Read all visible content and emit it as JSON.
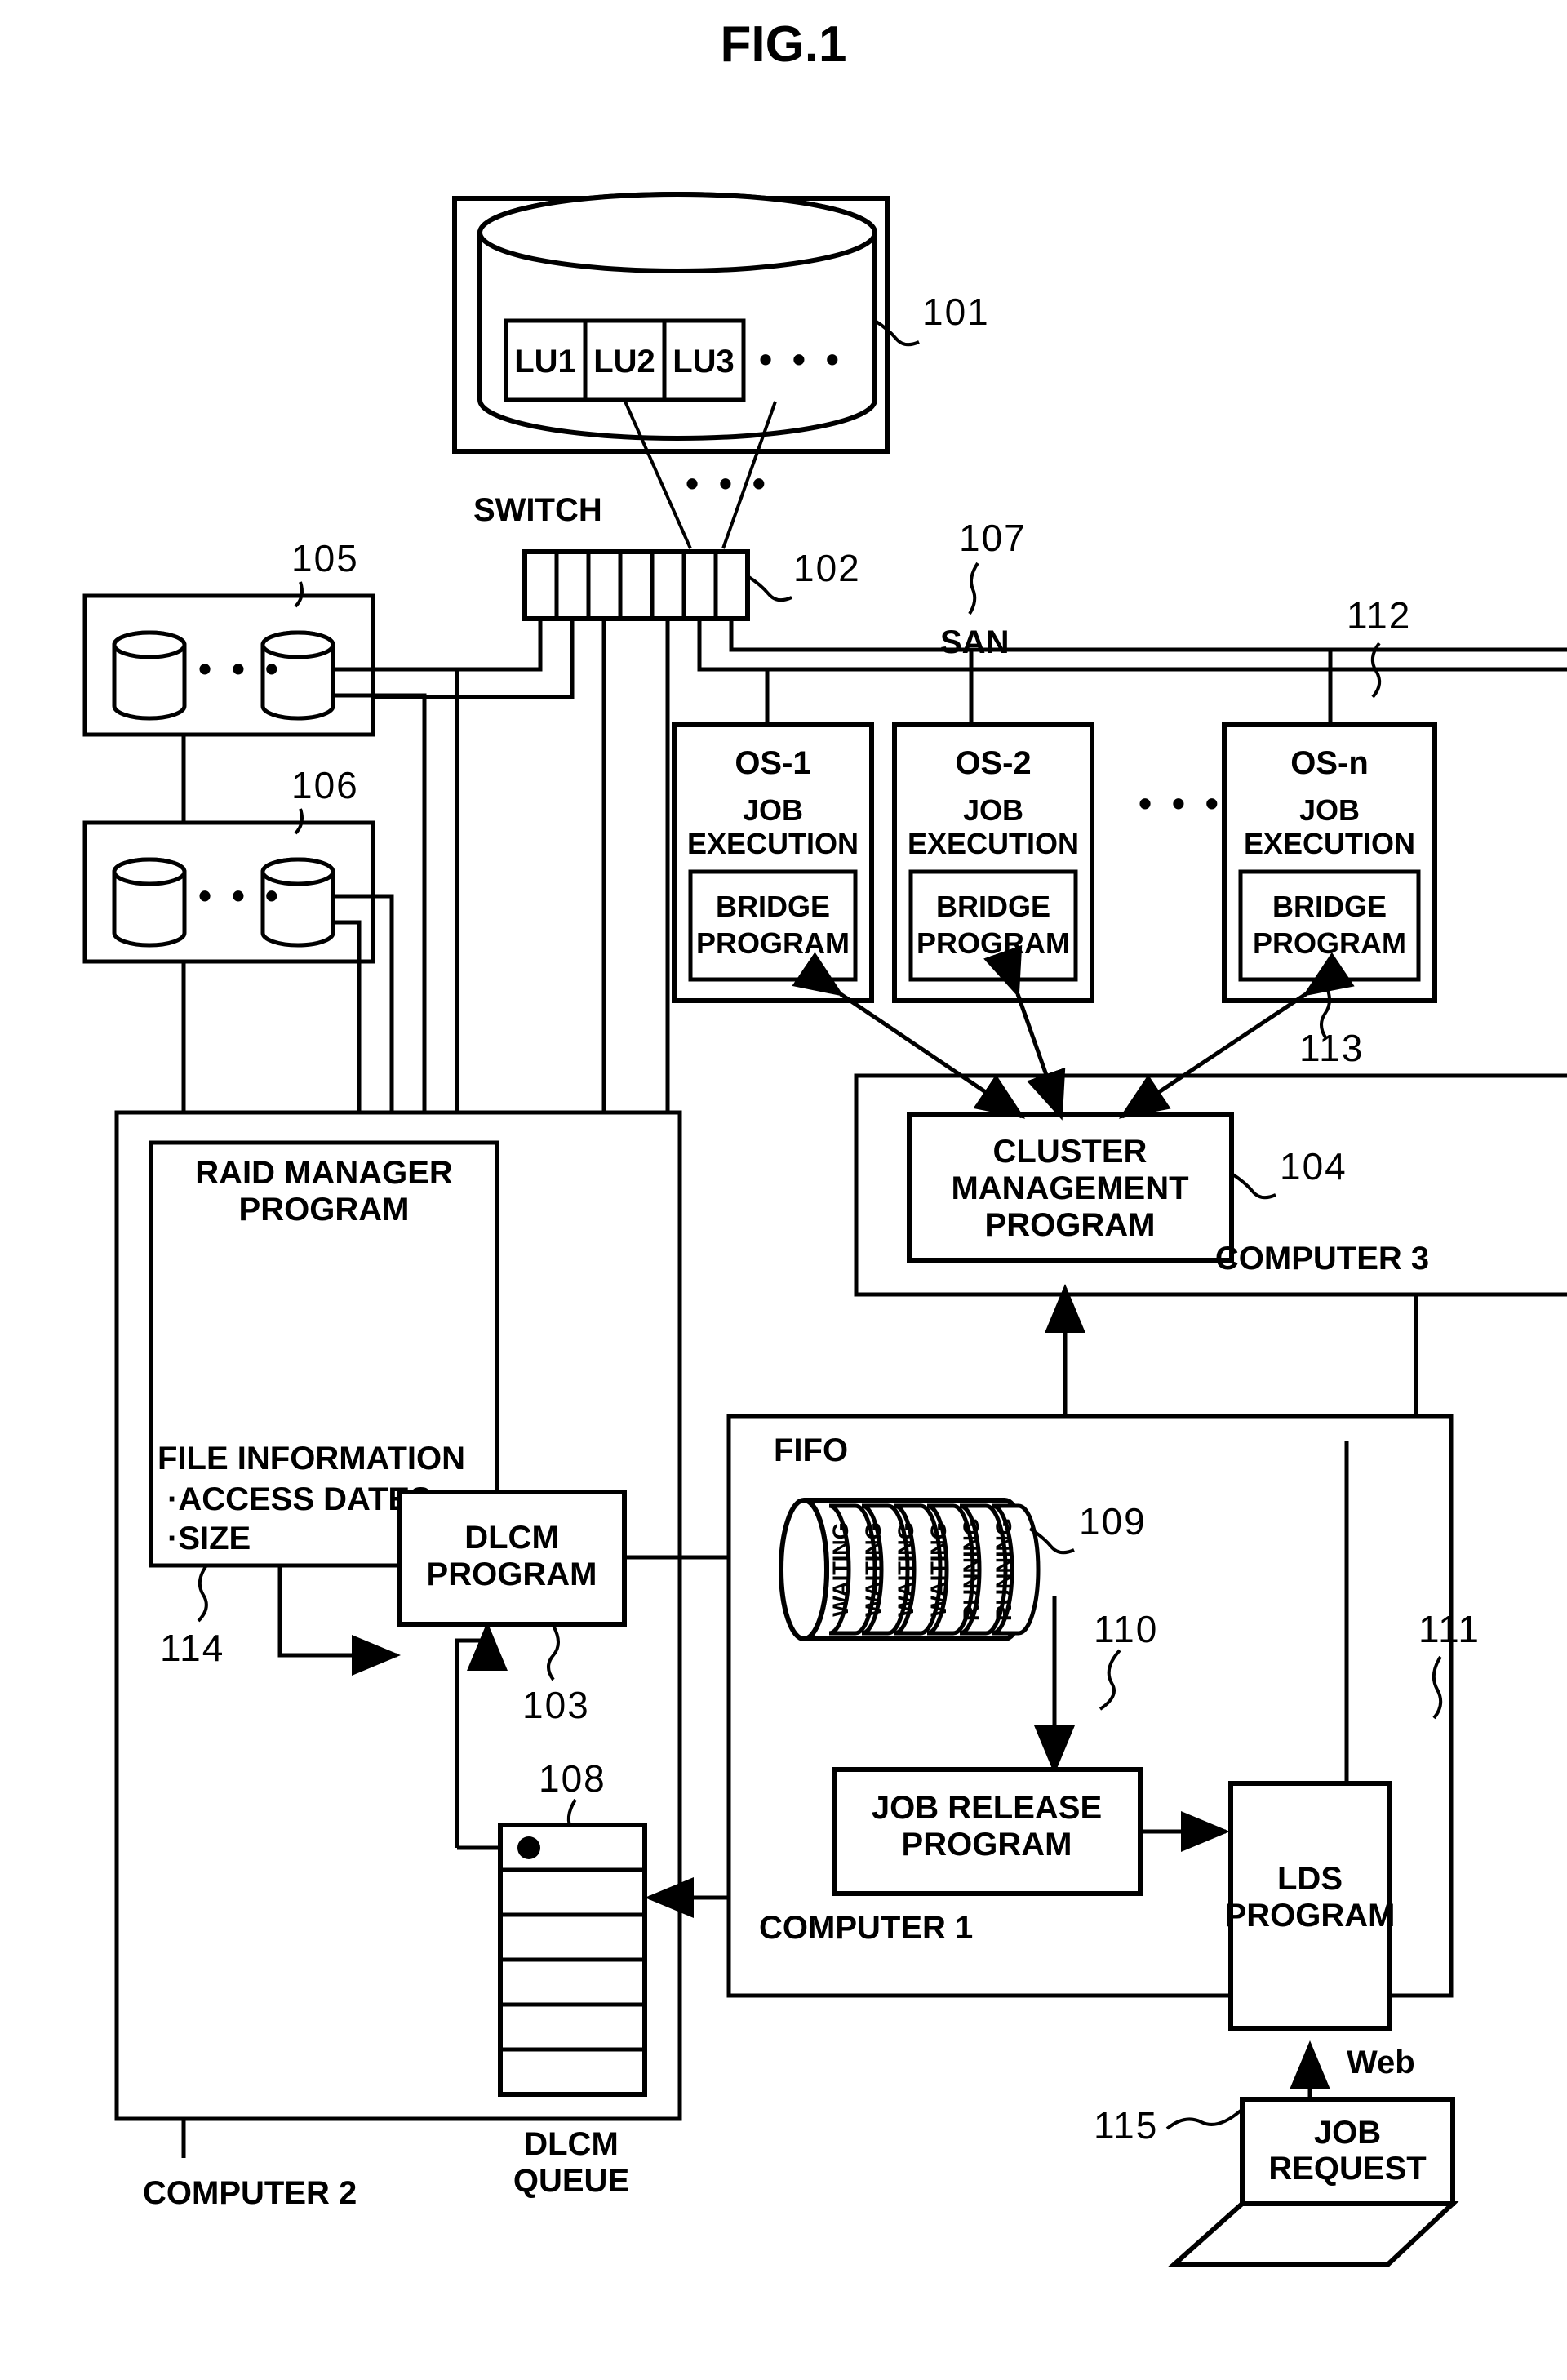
{
  "figure": {
    "title": "FIG.1"
  },
  "storage": {
    "ref": "101",
    "lus": [
      "LU1",
      "LU2",
      "LU3"
    ],
    "lu_ellipsis": "• • •",
    "link_ellipsis": "• • •"
  },
  "switch": {
    "label": "SWITCH",
    "ref": "102",
    "port_count": 7
  },
  "san": {
    "label": "SAN",
    "ref": "107"
  },
  "disk_arrays": [
    {
      "ref": "105",
      "ellipsis": "• • •"
    },
    {
      "ref": "106",
      "ellipsis": "• • •"
    }
  ],
  "os_nodes": [
    {
      "name": "OS-1",
      "line1": "JOB",
      "line2": "EXECUTION",
      "bridge_line1": "BRIDGE",
      "bridge_line2": "PROGRAM"
    },
    {
      "name": "OS-2",
      "line1": "JOB",
      "line2": "EXECUTION",
      "bridge_line1": "BRIDGE",
      "bridge_line2": "PROGRAM"
    },
    {
      "name": "OS-n",
      "line1": "JOB",
      "line2": "EXECUTION",
      "bridge_line1": "BRIDGE",
      "bridge_line2": "PROGRAM"
    }
  ],
  "os_ellipsis": "• • •",
  "os_refs": {
    "node": "112",
    "bridge": "113"
  },
  "computer3": {
    "label": "COMPUTER 3",
    "cluster_line1": "CLUSTER",
    "cluster_line2": "MANAGEMENT",
    "cluster_line3": "PROGRAM",
    "ref": "104"
  },
  "computer2": {
    "label": "COMPUTER 2",
    "raid_line1": "RAID MANAGER",
    "raid_line2": "PROGRAM",
    "file_info_title": "FILE INFORMATION",
    "file_info_items": [
      "·ACCESS DATES",
      "·SIZE"
    ],
    "raid_ref": "114",
    "dlcm_line1": "DLCM",
    "dlcm_line2": "PROGRAM",
    "dlcm_ref": "103",
    "queue_label_line1": "DLCM",
    "queue_label_line2": "QUEUE",
    "queue_ref": "108",
    "queue_slots": 6
  },
  "computer1": {
    "label": "COMPUTER 1",
    "fifo_label": "FIFO",
    "fifo_ref": "109",
    "fifo_slots": [
      "WAITING",
      "WAITING",
      "WAITING",
      "WAITING",
      "RUNNING",
      "RUNNING"
    ],
    "job_release_line1": "JOB RELEASE",
    "job_release_line2": "PROGRAM",
    "job_release_ref": "110",
    "lds_line1": "LDS",
    "lds_line2": "PROGRAM",
    "lds_ref": "111"
  },
  "client": {
    "web_label": "Web",
    "job_request_line1": "JOB",
    "job_request_line2": "REQUEST",
    "ref": "115"
  },
  "colors": {
    "ink": "#000000",
    "paper": "#ffffff"
  }
}
